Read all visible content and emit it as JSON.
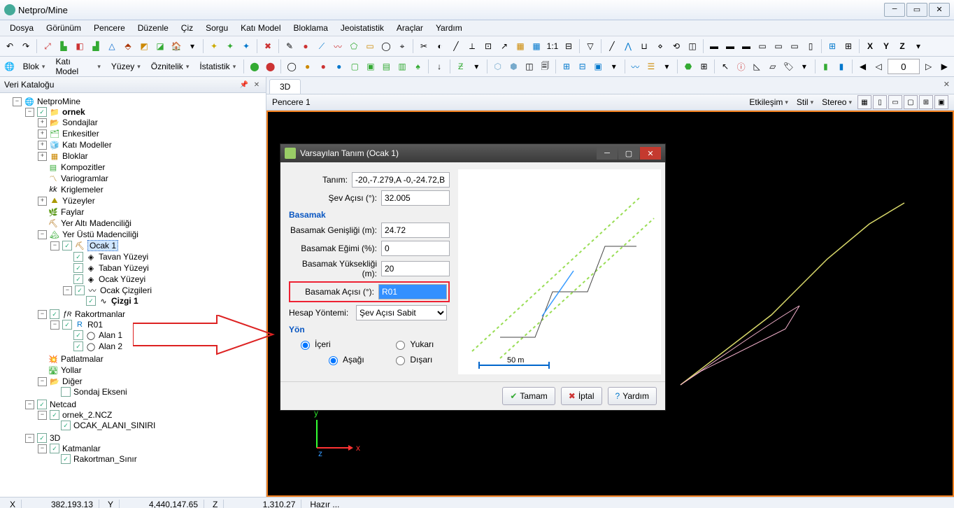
{
  "app": {
    "title": "Netpro/Mine"
  },
  "menu": [
    "Dosya",
    "Görünüm",
    "Pencere",
    "Düzenle",
    "Çiz",
    "Sorgu",
    "Katı Model",
    "Bloklama",
    "Jeoistatistik",
    "Araçlar",
    "Yardım"
  ],
  "toolbar2_dropdowns": [
    "Blok",
    "Katı Model",
    "Yüzey",
    "Öznitelik",
    "İstatistik"
  ],
  "toolbar2_xyz": [
    "X",
    "Y",
    "Z"
  ],
  "catalog": {
    "title": "Veri Kataloğu"
  },
  "tree": {
    "root": "NetproMine",
    "project": "ornek",
    "nodes": [
      "Sondajlar",
      "Enkesitler",
      "Katı Modeller",
      "Bloklar",
      "Kompozitler",
      "Variogramlar",
      "Kriglemeler",
      "Yüzeyler",
      "Faylar",
      "Yer Altı Madenciliği",
      "Yer Üstü Madenciliği"
    ],
    "ocak": "Ocak 1",
    "ocak_children": [
      "Tavan Yüzeyi",
      "Taban Yüzeyi",
      "Ocak Yüzeyi",
      "Ocak Çizgileri"
    ],
    "cizgi": "Çizgi 1",
    "rakort": "Rakortmanlar",
    "r01": "R01",
    "alanlar": [
      "Alan 1",
      "Alan 2"
    ],
    "rest": [
      "Patlatmalar",
      "Yollar",
      "Diğer"
    ],
    "sondaj_ekseni": "Sondaj Ekseni",
    "netcad": "Netcad",
    "ncz": "ornek_2.NCZ",
    "ocak_alani": "OCAK_ALANI_SINIRI",
    "three_d": "3D",
    "katmanlar": "Katmanlar",
    "rakort_sinir": "Rakortman_Sınır"
  },
  "view": {
    "tab": "3D",
    "pane": "Pencere 1",
    "controls": [
      "Etkileşim",
      "Stil",
      "Stereo"
    ]
  },
  "dialog": {
    "title": "Varsayılan Tanım (Ocak 1)",
    "labels": {
      "tanim": "Tanım:",
      "sev": "Şev Açısı  (°):",
      "basamak": "Basamak",
      "genislik": "Basamak Genişliği (m):",
      "egim": "Basamak Eğimi (%):",
      "yukseklik": "Basamak Yüksekliği (m):",
      "aci": "Basamak Açısı (°):",
      "hesap": "Hesap Yöntemi:",
      "yon": "Yön"
    },
    "values": {
      "tanim": "-20,-7.279,A -0,-24.72,B",
      "sev": "32.005",
      "genislik": "24.72",
      "egim": "0",
      "yukseklik": "20",
      "aci": "R01",
      "hesap": "Şev Açısı Sabit"
    },
    "radios": {
      "iceri": "İçeri",
      "yukari": "Yukarı",
      "disari": "Dışarı",
      "asagi": "Aşağı"
    },
    "scale": "50 m",
    "buttons": {
      "ok": "Tamam",
      "cancel": "İptal",
      "help": "Yardım"
    }
  },
  "status": {
    "x_lbl": "X",
    "x": "382,193.13",
    "y_lbl": "Y",
    "y": "4,440,147.65",
    "z_lbl": "Z",
    "z": "1,310.27",
    "msg": "Hazır ..."
  },
  "spin_value": "0"
}
